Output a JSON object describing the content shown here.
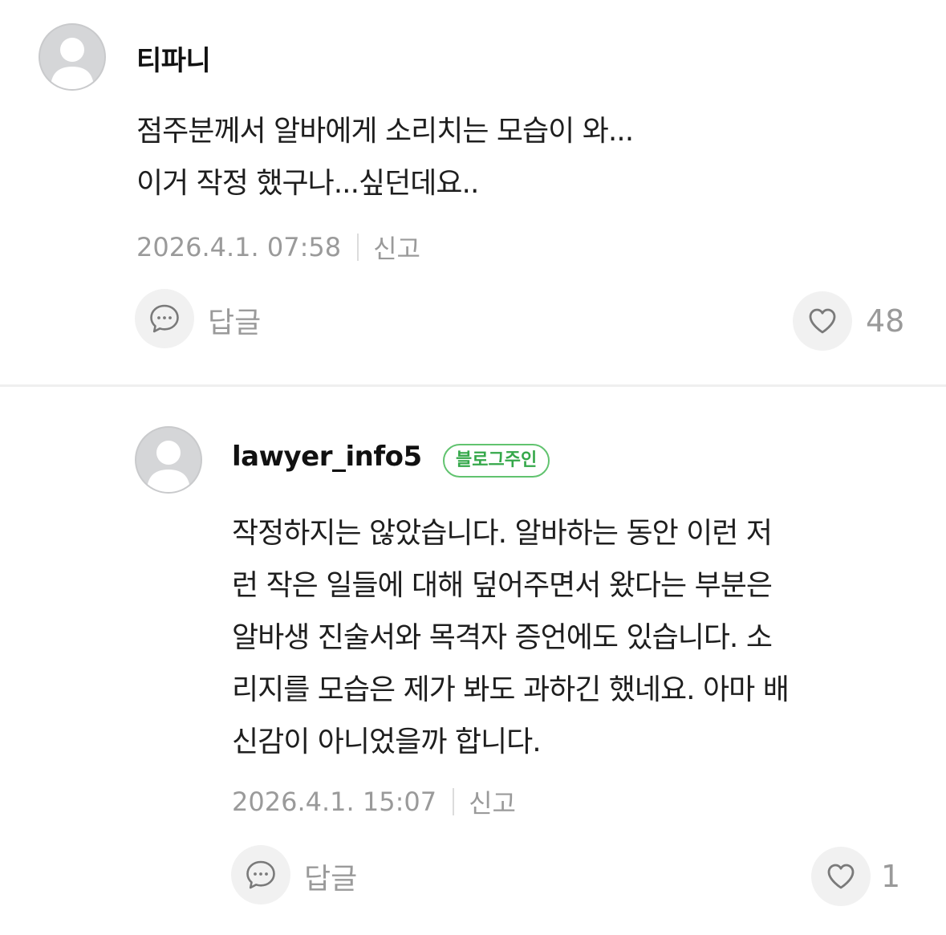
{
  "comments": [
    {
      "author": "티파니",
      "body_lines": [
        "점주분께서 알바에게 소리치는 모습이 와...",
        "이거 작정 했구나...싶던데요.."
      ],
      "timestamp": "2026.4.1. 07:58",
      "report_label": "신고",
      "reply_label": "답글",
      "like_count": "48",
      "avatar_icon": "default-user-icon",
      "reply_icon": "speech-bubble-icon",
      "like_icon": "heart-icon"
    },
    {
      "author": "lawyer_info5",
      "badge": "블로그주인",
      "body_lines": [
        "작정하지는 않았습니다. 알바하는 동안 이런 저",
        "런 작은 일들에 대해 덮어주면서 왔다는 부분은",
        "알바생 진술서와 목격자 증언에도 있습니다. 소",
        "리지를 모습은 제가 봐도 과하긴 했네요. 아마 배",
        "신감이 아니었을까 합니다."
      ],
      "timestamp": "2026.4.1. 15:07",
      "report_label": "신고",
      "reply_label": "답글",
      "like_count": "1",
      "avatar_icon": "default-user-icon",
      "reply_icon": "speech-bubble-icon",
      "like_icon": "heart-icon"
    }
  ],
  "colors": {
    "badge_green": "#35a84a",
    "text_primary": "#1e1e1e",
    "text_secondary": "#9a9a9a",
    "button_bg": "#f1f1f1",
    "avatar_bg": "#d5d6d8"
  }
}
